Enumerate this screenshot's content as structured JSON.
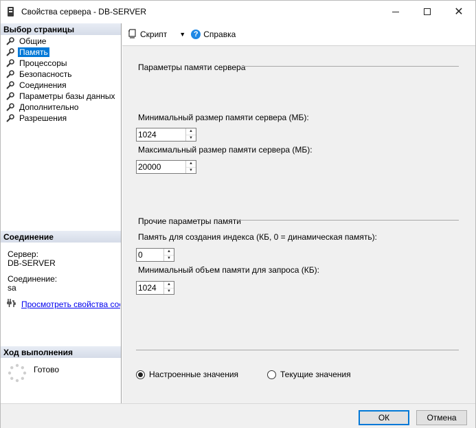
{
  "window": {
    "title": "Свойства сервера - DB-SERVER"
  },
  "left": {
    "pages_header": "Выбор страницы",
    "pages": [
      {
        "label": "Общие",
        "selected": false
      },
      {
        "label": "Память",
        "selected": true
      },
      {
        "label": "Процессоры",
        "selected": false
      },
      {
        "label": "Безопасность",
        "selected": false
      },
      {
        "label": "Соединения",
        "selected": false
      },
      {
        "label": "Параметры базы данных",
        "selected": false
      },
      {
        "label": "Дополнительно",
        "selected": false
      },
      {
        "label": "Разрешения",
        "selected": false
      }
    ],
    "connection_header": "Соединение",
    "server_label": "Сервер:",
    "server_value": "DB-SERVER",
    "connection_label": "Соединение:",
    "connection_value": "sa",
    "view_link": "Просмотреть свойства соединения",
    "progress_header": "Ход выполнения",
    "progress_status": "Готово"
  },
  "toolbar": {
    "script_label": "Скрипт",
    "help_label": "Справка"
  },
  "memory": {
    "server_group": "Параметры памяти сервера",
    "min_label": "Минимальный размер памяти сервера (МБ):",
    "min_value": "1024",
    "max_label": "Максимальный размер памяти сервера (МБ):",
    "max_value": "20000",
    "other_group": "Прочие параметры памяти",
    "index_label": "Память для создания индекса (КБ, 0 = динамическая память):",
    "index_value": "0",
    "query_label": "Минимальный объем памяти для запроса (КБ):",
    "query_value": "1024",
    "radio_configured": "Настроенные значения",
    "radio_running": "Текущие значения",
    "radio_selected": "configured"
  },
  "buttons": {
    "ok": "ОК",
    "cancel": "Отмена"
  }
}
